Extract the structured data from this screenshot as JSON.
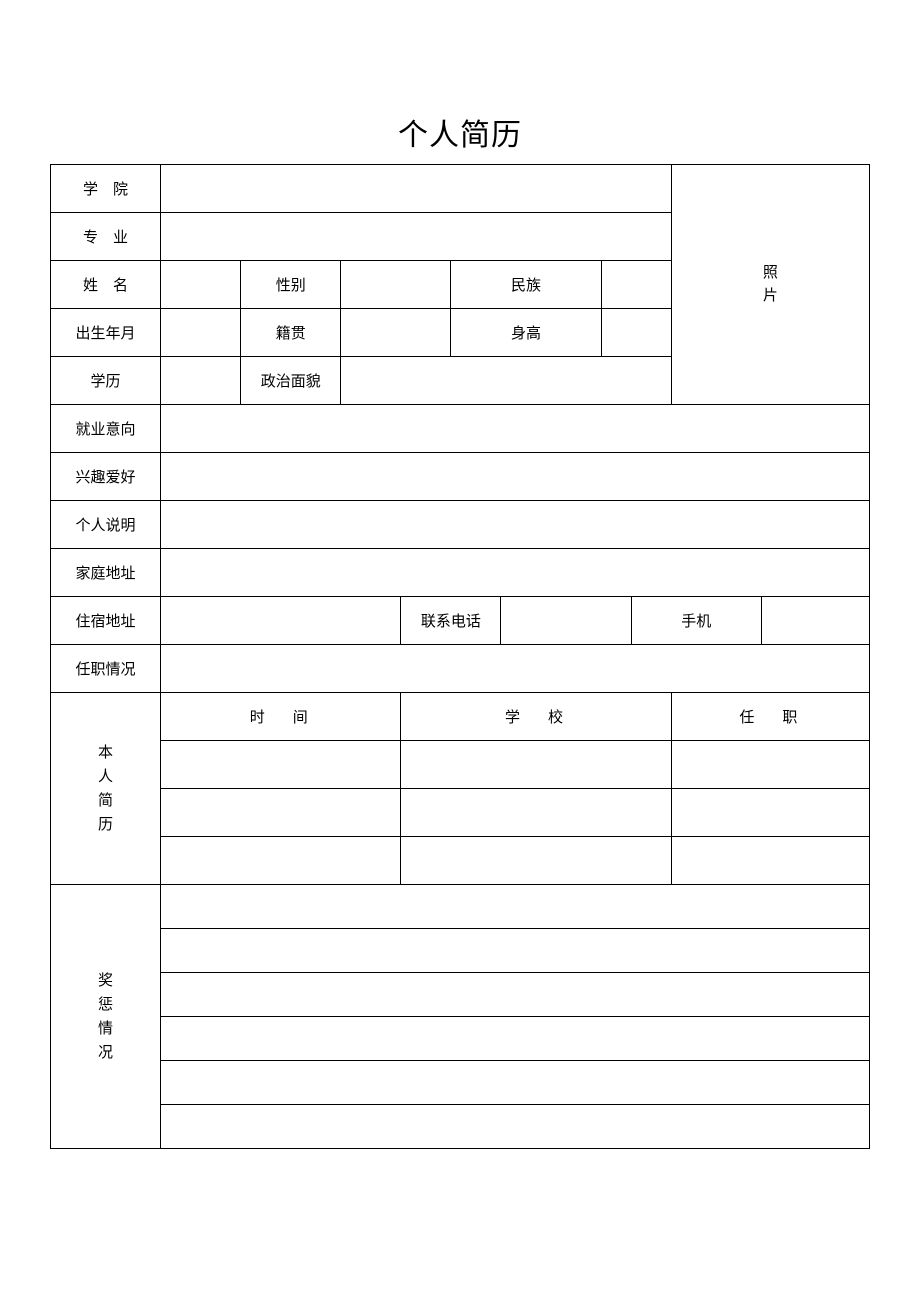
{
  "title": "个人简历",
  "labels": {
    "college": "学　院",
    "major": "专　业",
    "name": "姓　名",
    "gender": "性别",
    "ethnicity": "民族",
    "birth": "出生年月",
    "native_place": "籍贯",
    "height": "身高",
    "education": "学历",
    "political": "政治面貌",
    "job_intention": "就业意向",
    "hobbies": "兴趣爱好",
    "personal_desc": "个人说明",
    "home_address": "家庭地址",
    "dorm_address": "住宿地址",
    "phone": "联系电话",
    "mobile": "手机",
    "positions_held": "任职情况",
    "history_header_time": "时间",
    "history_header_school": "学校",
    "history_header_post": "任职"
  },
  "photo_label_1": "照",
  "photo_label_2": "片",
  "history_label_1": "本",
  "history_label_2": "人",
  "history_label_3": "简",
  "history_label_4": "历",
  "rewards_label_1": "奖",
  "rewards_label_2": "惩",
  "rewards_label_3": "情",
  "rewards_label_4": "况",
  "values": {
    "college": "",
    "major": "",
    "name": "",
    "gender": "",
    "ethnicity": "",
    "birth": "",
    "native_place": "",
    "height": "",
    "education": "",
    "political": "",
    "job_intention": "",
    "hobbies": "",
    "personal_desc": "",
    "home_address": "",
    "dorm_address": "",
    "phone": "",
    "mobile": "",
    "positions_held": "",
    "history": [
      {
        "time": "",
        "school": "",
        "post": ""
      },
      {
        "time": "",
        "school": "",
        "post": ""
      },
      {
        "time": "",
        "school": "",
        "post": ""
      }
    ],
    "rewards": [
      "",
      "",
      "",
      "",
      "",
      ""
    ]
  }
}
